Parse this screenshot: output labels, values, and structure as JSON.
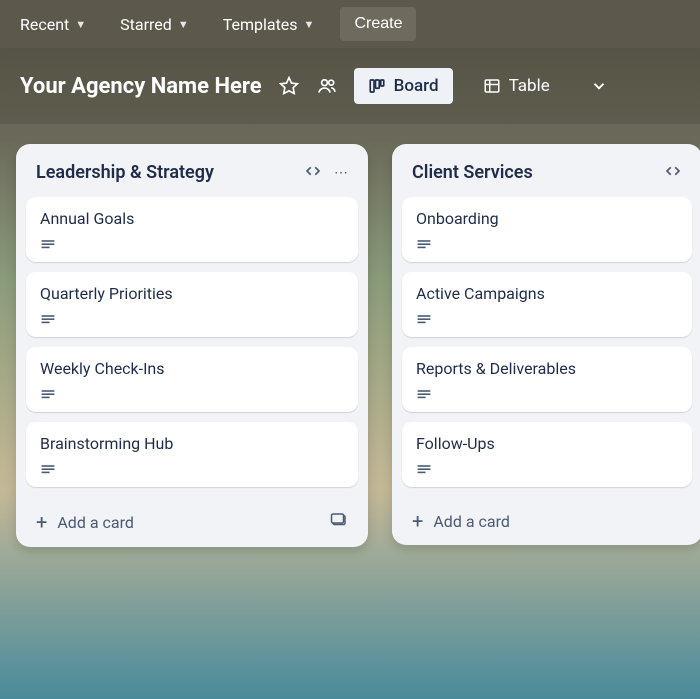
{
  "topnav": {
    "recent": "Recent",
    "starred": "Starred",
    "templates": "Templates",
    "create": "Create"
  },
  "board": {
    "title": "Your Agency Name Here",
    "views": {
      "board": "Board",
      "table": "Table"
    }
  },
  "lists": [
    {
      "title": "Leadership & Strategy",
      "cards": [
        {
          "title": "Annual Goals"
        },
        {
          "title": "Quarterly Priorities"
        },
        {
          "title": "Weekly Check-Ins"
        },
        {
          "title": "Brainstorming Hub"
        }
      ],
      "add_label": "Add a card"
    },
    {
      "title": "Client Services",
      "cards": [
        {
          "title": "Onboarding"
        },
        {
          "title": "Active Campaigns"
        },
        {
          "title": "Reports & Deliverables"
        },
        {
          "title": "Follow-Ups"
        }
      ],
      "add_label": "Add a card"
    }
  ]
}
